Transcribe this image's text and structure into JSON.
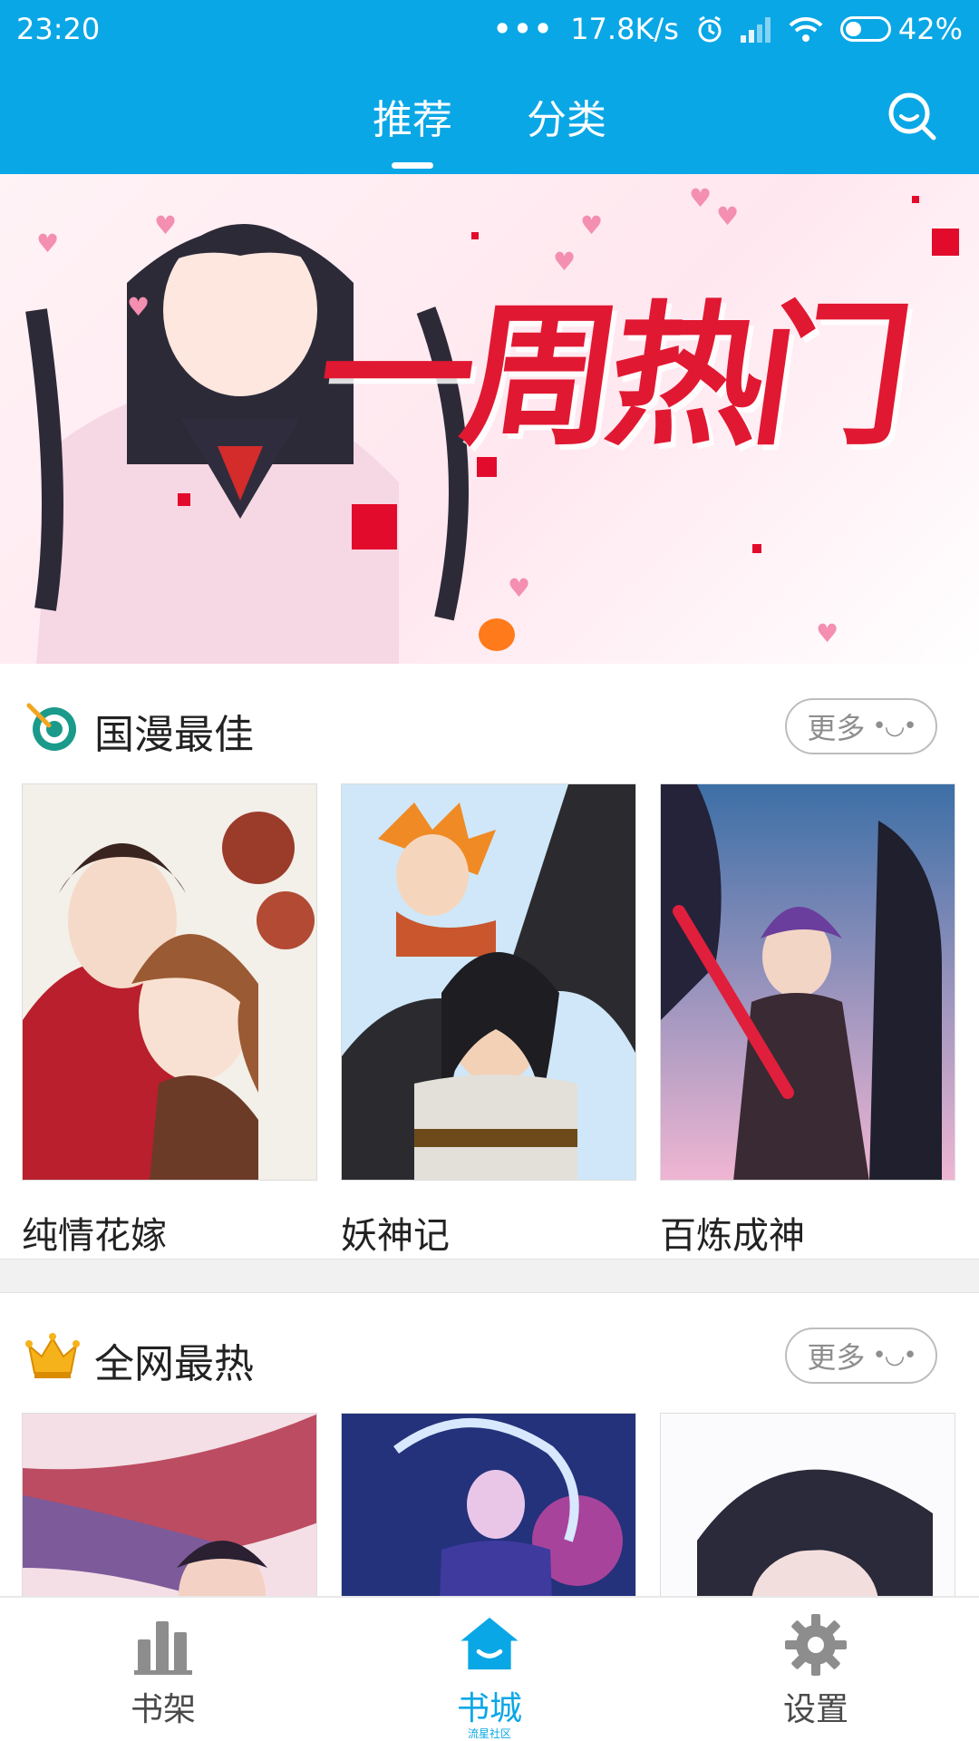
{
  "status_bar": {
    "time": "23:20",
    "dots": "•••",
    "net_speed": "17.8K/s",
    "battery_pct": "42%"
  },
  "header": {
    "tabs": [
      {
        "label": "推荐",
        "active": true
      },
      {
        "label": "分类",
        "active": false
      }
    ],
    "search_icon": "search-icon"
  },
  "banner": {
    "title": "一周热门"
  },
  "sections": [
    {
      "title": "国漫最佳",
      "icon": "target-icon",
      "more_label": "更多",
      "more_face": "•◡•",
      "items": [
        {
          "title": "纯情花嫁",
          "accent": "#b91f2c"
        },
        {
          "title": "妖神记",
          "accent": "#3f8fd1"
        },
        {
          "title": "百炼成神",
          "accent": "#5b3d8b"
        }
      ]
    },
    {
      "title": "全网最热",
      "icon": "crown-icon",
      "more_label": "更多",
      "more_face": "•◡•",
      "items": [
        {
          "title": "",
          "accent": "#b1334a"
        },
        {
          "title": "",
          "accent": "#23327a"
        },
        {
          "title": "",
          "accent": "#2a2a3a"
        }
      ]
    }
  ],
  "bottom_nav": {
    "items": [
      {
        "label": "书架",
        "icon": "bookshelf-icon",
        "active": false
      },
      {
        "label": "书城",
        "sub": "流星社区",
        "icon": "home-icon",
        "active": true
      },
      {
        "label": "设置",
        "icon": "gear-icon",
        "active": false
      }
    ]
  },
  "colors": {
    "primary": "#0aa7e6",
    "banner_red": "#e11832"
  }
}
